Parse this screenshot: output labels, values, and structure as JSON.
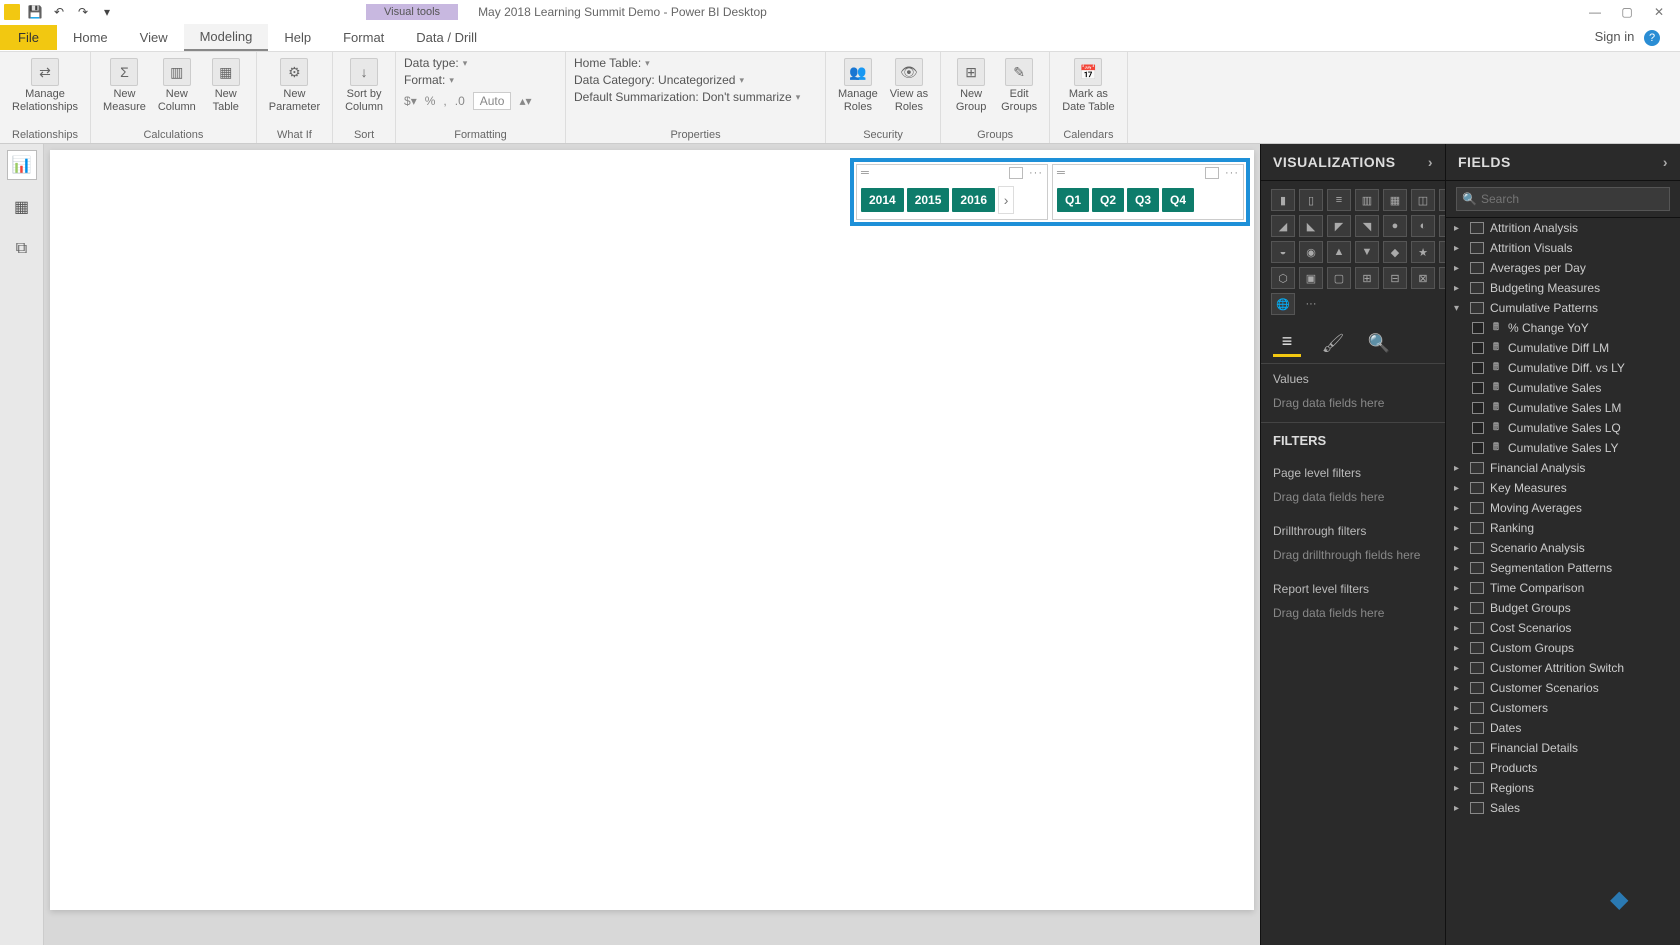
{
  "titlebar": {
    "visual_tools": "Visual tools",
    "doc_title": "May 2018 Learning Summit Demo - Power BI Desktop"
  },
  "signin": "Sign in",
  "ribbon_tabs": {
    "file": "File",
    "home": "Home",
    "view": "View",
    "modeling": "Modeling",
    "help": "Help",
    "format": "Format",
    "data_drill": "Data / Drill"
  },
  "ribbon": {
    "relationships": {
      "manage": "Manage\nRelationships",
      "group": "Relationships"
    },
    "calculations": {
      "new_measure": "New\nMeasure",
      "new_column": "New\nColumn",
      "new_table": "New\nTable",
      "group": "Calculations"
    },
    "whatif": {
      "new_parameter": "New\nParameter",
      "group": "What If"
    },
    "sort": {
      "sort_by": "Sort by\nColumn",
      "group": "Sort"
    },
    "formatting": {
      "data_type": "Data type:",
      "format": "Format:",
      "auto": "Auto",
      "group": "Formatting"
    },
    "properties": {
      "home_table": "Home Table:",
      "data_category": "Data Category: Uncategorized",
      "default_summarization": "Default Summarization: Don't summarize",
      "group": "Properties"
    },
    "security": {
      "manage_roles": "Manage\nRoles",
      "view_as_roles": "View as\nRoles",
      "group": "Security"
    },
    "groups": {
      "new_group": "New\nGroup",
      "edit_groups": "Edit\nGroups",
      "group": "Groups"
    },
    "calendars": {
      "mark_as_date": "Mark as\nDate Table",
      "group": "Calendars"
    }
  },
  "slicers": {
    "years": [
      "2014",
      "2015",
      "2016"
    ],
    "quarters": [
      "Q1",
      "Q2",
      "Q3",
      "Q4"
    ]
  },
  "viz_panel": {
    "header": "VISUALIZATIONS",
    "values": "Values",
    "drag_data": "Drag data fields here",
    "filters_hdr": "FILTERS",
    "page_filters": "Page level filters",
    "drag_page": "Drag data fields here",
    "drill_filters": "Drillthrough filters",
    "drag_drill": "Drag drillthrough fields here",
    "report_filters": "Report level filters",
    "drag_report": "Drag data fields here"
  },
  "fields_panel": {
    "header": "FIELDS",
    "search_placeholder": "Search",
    "tables": [
      {
        "name": "Attrition Analysis",
        "expanded": false
      },
      {
        "name": "Attrition Visuals",
        "expanded": false
      },
      {
        "name": "Averages per Day",
        "expanded": false
      },
      {
        "name": "Budgeting Measures",
        "expanded": false
      },
      {
        "name": "Cumulative Patterns",
        "expanded": true,
        "children": [
          "% Change YoY",
          "Cumulative Diff LM",
          "Cumulative Diff. vs LY",
          "Cumulative Sales",
          "Cumulative Sales LM",
          "Cumulative Sales LQ",
          "Cumulative Sales LY"
        ]
      },
      {
        "name": "Financial Analysis",
        "expanded": false
      },
      {
        "name": "Key Measures",
        "expanded": false
      },
      {
        "name": "Moving Averages",
        "expanded": false
      },
      {
        "name": "Ranking",
        "expanded": false
      },
      {
        "name": "Scenario Analysis",
        "expanded": false
      },
      {
        "name": "Segmentation Patterns",
        "expanded": false
      },
      {
        "name": "Time Comparison",
        "expanded": false
      },
      {
        "name": "Budget Groups",
        "expanded": false
      },
      {
        "name": "Cost Scenarios",
        "expanded": false
      },
      {
        "name": "Custom Groups",
        "expanded": false
      },
      {
        "name": "Customer Attrition Switch",
        "expanded": false
      },
      {
        "name": "Customer Scenarios",
        "expanded": false
      },
      {
        "name": "Customers",
        "expanded": false
      },
      {
        "name": "Dates",
        "expanded": false
      },
      {
        "name": "Financial Details",
        "expanded": false
      },
      {
        "name": "Products",
        "expanded": false
      },
      {
        "name": "Regions",
        "expanded": false
      },
      {
        "name": "Sales",
        "expanded": false
      }
    ]
  }
}
